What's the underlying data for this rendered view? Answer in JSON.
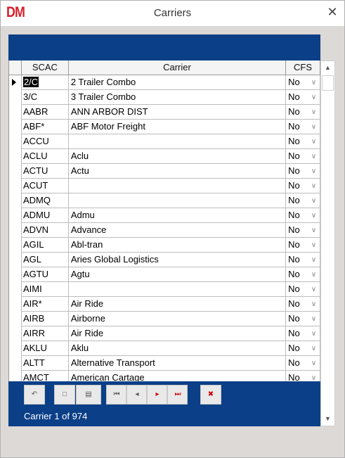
{
  "window": {
    "logo": "DM",
    "title": "Carriers",
    "close_glyph": "✕"
  },
  "grid": {
    "columns": [
      "SCAC",
      "Carrier",
      "CFS"
    ],
    "rows": [
      {
        "scac": "2/C",
        "carrier": "2 Trailer Combo",
        "cfs": "No"
      },
      {
        "scac": "3/C",
        "carrier": "3 Trailer Combo",
        "cfs": "No"
      },
      {
        "scac": "AABR",
        "carrier": "ANN ARBOR DIST",
        "cfs": "No"
      },
      {
        "scac": "ABF*",
        "carrier": "ABF Motor Freight",
        "cfs": "No"
      },
      {
        "scac": "ACCU",
        "carrier": "",
        "cfs": "No"
      },
      {
        "scac": "ACLU",
        "carrier": "Aclu",
        "cfs": "No"
      },
      {
        "scac": "ACTU",
        "carrier": "Actu",
        "cfs": "No"
      },
      {
        "scac": "ACUT",
        "carrier": "",
        "cfs": "No"
      },
      {
        "scac": "ADMQ",
        "carrier": "",
        "cfs": "No"
      },
      {
        "scac": "ADMU",
        "carrier": "Admu",
        "cfs": "No"
      },
      {
        "scac": "ADVN",
        "carrier": "Advance",
        "cfs": "No"
      },
      {
        "scac": "AGIL",
        "carrier": "Abl-tran",
        "cfs": "No"
      },
      {
        "scac": "AGL",
        "carrier": "Aries Global Logistics",
        "cfs": "No"
      },
      {
        "scac": "AGTU",
        "carrier": "Agtu",
        "cfs": "No"
      },
      {
        "scac": "AIMI",
        "carrier": "",
        "cfs": "No"
      },
      {
        "scac": "AIR*",
        "carrier": "Air Ride",
        "cfs": "No"
      },
      {
        "scac": "AIRB",
        "carrier": "Airborne",
        "cfs": "No"
      },
      {
        "scac": "AIRR",
        "carrier": "Air Ride",
        "cfs": "No"
      },
      {
        "scac": "AKLU",
        "carrier": "Aklu",
        "cfs": "No"
      },
      {
        "scac": "ALTT",
        "carrier": "Alternative Transport",
        "cfs": "No"
      },
      {
        "scac": "AMCT",
        "carrier": "American Cartage",
        "cfs": "No"
      }
    ],
    "selected_row": 0
  },
  "navigator": {
    "buttons": [
      {
        "name": "undo-button",
        "glyph": "↶"
      },
      {
        "name": "new-record-button",
        "glyph": "□"
      },
      {
        "name": "save-record-button",
        "glyph": "▤"
      },
      {
        "name": "first-record-button",
        "glyph": "⏮"
      },
      {
        "name": "previous-record-button",
        "glyph": "◂"
      },
      {
        "name": "next-record-button",
        "glyph": "▸"
      },
      {
        "name": "last-record-button",
        "glyph": "⏭"
      },
      {
        "name": "delete-record-button",
        "glyph": "✖"
      }
    ],
    "status": "Carrier 1 of 974"
  },
  "colors": {
    "accent": "#0b3f87",
    "logo": "#d7202b",
    "background": "#ddd9d6"
  }
}
